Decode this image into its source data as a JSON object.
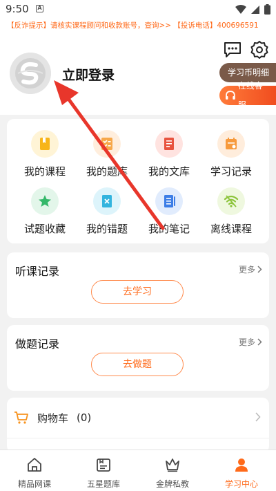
{
  "status": {
    "time": "9:50",
    "sim": "A"
  },
  "notice": "【反诈提示】请核实课程顾问和收款账号，查询>> 【投诉电话】400696591",
  "profile": {
    "login_text": "立即登录"
  },
  "pills": {
    "coin_detail": "学习币明细",
    "online_service": "在线客服"
  },
  "grid": [
    {
      "label": "我的课程",
      "icon": "book-icon",
      "bg": "#fff4d6",
      "color": "#f7b519"
    },
    {
      "label": "我的题库",
      "icon": "checklist-icon",
      "bg": "#ffeedd",
      "color": "#f7a84a"
    },
    {
      "label": "我的文库",
      "icon": "document-icon",
      "bg": "#ffe3e0",
      "color": "#e8533f"
    },
    {
      "label": "学习记录",
      "icon": "calendar-icon",
      "bg": "#ffeddc",
      "color": "#f79a3c"
    },
    {
      "label": "试题收藏",
      "icon": "star-icon",
      "bg": "#e3f6ea",
      "color": "#34b86a"
    },
    {
      "label": "我的错题",
      "icon": "error-note-icon",
      "bg": "#ddf4fb",
      "color": "#33b4de"
    },
    {
      "label": "我的笔记",
      "icon": "notebook-icon",
      "bg": "#e1ecfd",
      "color": "#3c7de6"
    },
    {
      "label": "离线课程",
      "icon": "wifi-icon",
      "bg": "#eff8df",
      "color": "#8cc43b"
    }
  ],
  "listen_record": {
    "title": "听课记录",
    "more": "更多",
    "button": "去学习"
  },
  "exercise_record": {
    "title": "做题记录",
    "more": "更多",
    "button": "去做题"
  },
  "cart": {
    "label": "购物车",
    "count": "(0)"
  },
  "tabs": [
    {
      "label": "精品网课",
      "icon": "home-icon",
      "active": false
    },
    {
      "label": "五星题库",
      "icon": "question-bank-icon",
      "active": false
    },
    {
      "label": "金牌私教",
      "icon": "crown-icon",
      "active": false
    },
    {
      "label": "学习中心",
      "icon": "user-icon",
      "active": true
    }
  ],
  "colors": {
    "accent": "#ff6a1a",
    "annotation": "#e8362b"
  }
}
